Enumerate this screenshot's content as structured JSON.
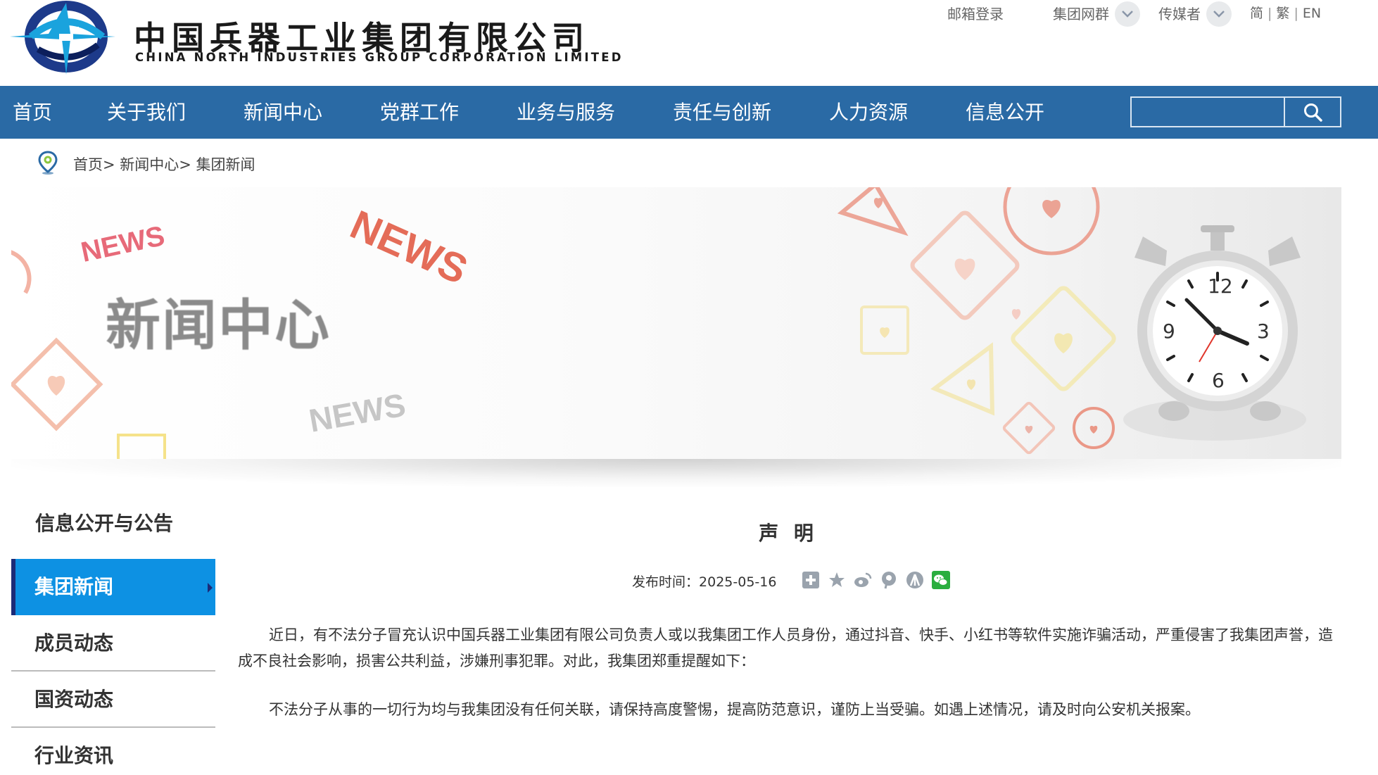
{
  "header": {
    "logo_cn": "中国兵器工业集团有限公司",
    "logo_en": "CHINA NORTH INDUSTRIES GROUP CORPORATION LIMITED",
    "top_links": {
      "mail_login": "邮箱登录",
      "group_network": "集团网群",
      "media": "传媒者"
    },
    "lang": {
      "simplified": "简",
      "traditional": "繁",
      "english": "EN"
    }
  },
  "nav": {
    "items": [
      "首页",
      "关于我们",
      "新闻中心",
      "党群工作",
      "业务与服务",
      "责任与创新",
      "人力资源",
      "信息公开"
    ],
    "search": {
      "placeholder": "",
      "value": ""
    }
  },
  "breadcrumb": {
    "text": "首页> 新闻中心> 集团新闻"
  },
  "banner": {
    "title": "新闻中心",
    "news_words": [
      "NEWS",
      "NEWS",
      "NEWS"
    ],
    "clock_numbers": [
      "12",
      "3",
      "6",
      "9"
    ]
  },
  "sidebar": {
    "heading": "信息公开与公告",
    "items": [
      {
        "label": "集团新闻",
        "active": true
      },
      {
        "label": "成员动态",
        "active": false
      },
      {
        "label": "国资动态",
        "active": false
      },
      {
        "label": "行业资讯",
        "active": false
      }
    ]
  },
  "article": {
    "title": "声 明",
    "publish_label": "发布时间：",
    "publish_date": "2025-05-16",
    "share_icons": [
      "plus-share-icon",
      "star-favorite-icon",
      "weibo-icon",
      "pinterest-icon",
      "renren-icon",
      "wechat-icon"
    ],
    "paragraphs": [
      "近日，有不法分子冒充认识中国兵器工业集团有限公司负责人或以我集团工作人员身份，通过抖音、快手、小红书等软件实施诈骗活动，严重侵害了我集团声誉，造成不良社会影响，损害公共利益，涉嫌刑事犯罪。对此，我集团郑重提醒如下：",
      "不法分子从事的一切行为均与我集团没有任何关联，请保持高度警惕，提高防范意识，谨防上当受骗。如遇上述情况，请及时向公安机关报案。"
    ]
  },
  "colors": {
    "nav_bg": "#2a6aa5",
    "sidebar_active": "#0d91e3",
    "sidebar_active_edge": "#1b2a78",
    "wechat_green": "#2aae3f"
  }
}
